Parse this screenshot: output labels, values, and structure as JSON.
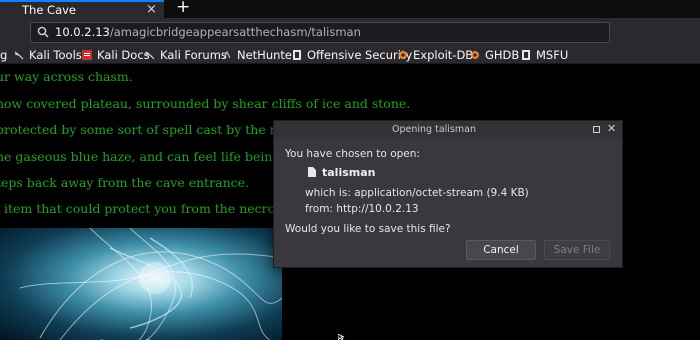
{
  "browser": {
    "tab": {
      "title": "The Cave",
      "close": "×"
    },
    "new_tab": "+",
    "url": {
      "host": "10.0.2.13",
      "path": "/amagicbridgeappearsatthechasm/talisman"
    }
  },
  "bookmarks": [
    {
      "label": "g"
    },
    {
      "label": "Kali Tools"
    },
    {
      "label": "Kali Docs"
    },
    {
      "label": "Kali Forums"
    },
    {
      "label": "NetHunter"
    },
    {
      "label": "Offensive Security"
    },
    {
      "label": "Exploit-DB"
    },
    {
      "label": "GHDB"
    },
    {
      "label": "MSFU"
    }
  ],
  "page": {
    "lines": [
      "ur way across chasm.",
      "now covered plateau, surrounded by shear cliffs of ice and stone.",
      "protected by some sort of spell cast by the necron",
      "he gaseous blue haze, and can feel life being dra",
      "teps back away from the cave entrance.",
      "l item that could protect you from the necromanc"
    ],
    "text_color": "#1ea51e"
  },
  "dialog": {
    "title": "Opening talisman",
    "intro": "You have chosen to open:",
    "filename": "talisman",
    "which_is": "which is: application/octet-stream (9.4 KB)",
    "from": "from: http://10.0.2.13",
    "question": "Would you like to save this file?",
    "cancel": "Cancel",
    "save": "Save File"
  }
}
